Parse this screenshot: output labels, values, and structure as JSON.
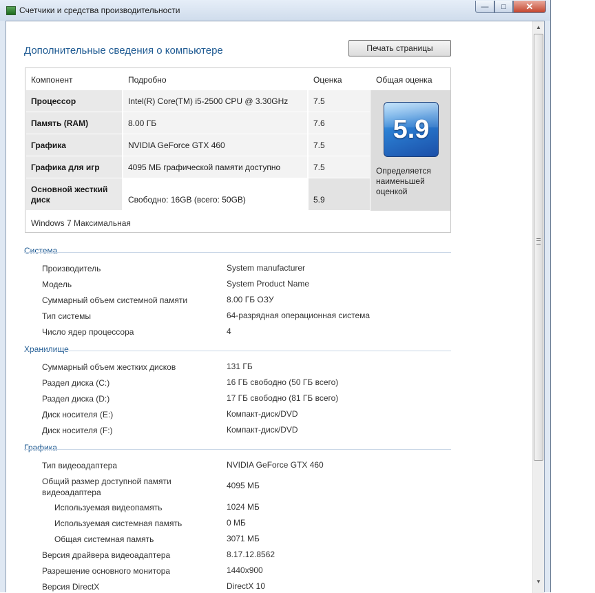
{
  "window": {
    "title": "Счетчики и средства производительности"
  },
  "page": {
    "heading": "Дополнительные сведения о компьютере",
    "print_button": "Печать страницы"
  },
  "wei": {
    "headers": {
      "component": "Компонент",
      "details": "Подробно",
      "score": "Оценка",
      "overall": "Общая оценка"
    },
    "rows": [
      {
        "component": "Процессор",
        "details": "Intel(R) Core(TM) i5-2500 CPU @ 3.30GHz",
        "score": "7.5"
      },
      {
        "component": "Память (RAM)",
        "details": "8.00 ГБ",
        "score": "7.6"
      },
      {
        "component": "Графика",
        "details": "NVIDIA GeForce GTX 460",
        "score": "7.5"
      },
      {
        "component": "Графика для игр",
        "details": "4095 МБ графической памяти доступно",
        "score": "7.5"
      },
      {
        "component": "Основной жесткий диск",
        "details": "Свободно: 16GB (всего: 50GB)",
        "score": "5.9"
      }
    ],
    "base_score": "5.9",
    "overall_note": "Определяется наименьшей оценкой",
    "footer": "Windows 7 Максимальная"
  },
  "system": {
    "title": "Система",
    "items": [
      {
        "label": "Производитель",
        "value": "System manufacturer"
      },
      {
        "label": "Модель",
        "value": "System Product Name"
      },
      {
        "label": "Суммарный объем системной памяти",
        "value": "8.00 ГБ ОЗУ"
      },
      {
        "label": "Тип системы",
        "value": "64-разрядная операционная система"
      },
      {
        "label": "Число ядер процессора",
        "value": "4"
      }
    ]
  },
  "storage": {
    "title": "Хранилище",
    "items": [
      {
        "label": "Суммарный объем жестких дисков",
        "value": "131 ГБ"
      },
      {
        "label": "Раздел диска (C:)",
        "value": "16 ГБ свободно (50 ГБ всего)"
      },
      {
        "label": "Раздел диска (D:)",
        "value": "17 ГБ свободно (81 ГБ всего)"
      },
      {
        "label": "Диск носителя (E:)",
        "value": "Компакт-диск/DVD"
      },
      {
        "label": "Диск носителя (F:)",
        "value": "Компакт-диск/DVD"
      }
    ]
  },
  "graphics": {
    "title": "Графика",
    "items": [
      {
        "label": "Тип видеоадаптера",
        "value": "NVIDIA GeForce GTX 460"
      },
      {
        "label": "Общий размер доступной памяти видеоадаптера",
        "value": "4095 МБ"
      },
      {
        "label": "Используемая видеопамять",
        "value": "1024 МБ"
      },
      {
        "label": "Используемая системная память",
        "value": "0 МБ"
      },
      {
        "label": "Общая системная память",
        "value": "3071 МБ"
      },
      {
        "label": "Версия драйвера видеоадаптера",
        "value": "8.17.12.8562"
      },
      {
        "label": "Разрешение основного монитора",
        "value": "1440x900"
      },
      {
        "label": "Версия DirectX",
        "value": "DirectX 10"
      }
    ]
  },
  "colors": {
    "heading": "#1e5a92",
    "badge": "#2b7fd3"
  }
}
